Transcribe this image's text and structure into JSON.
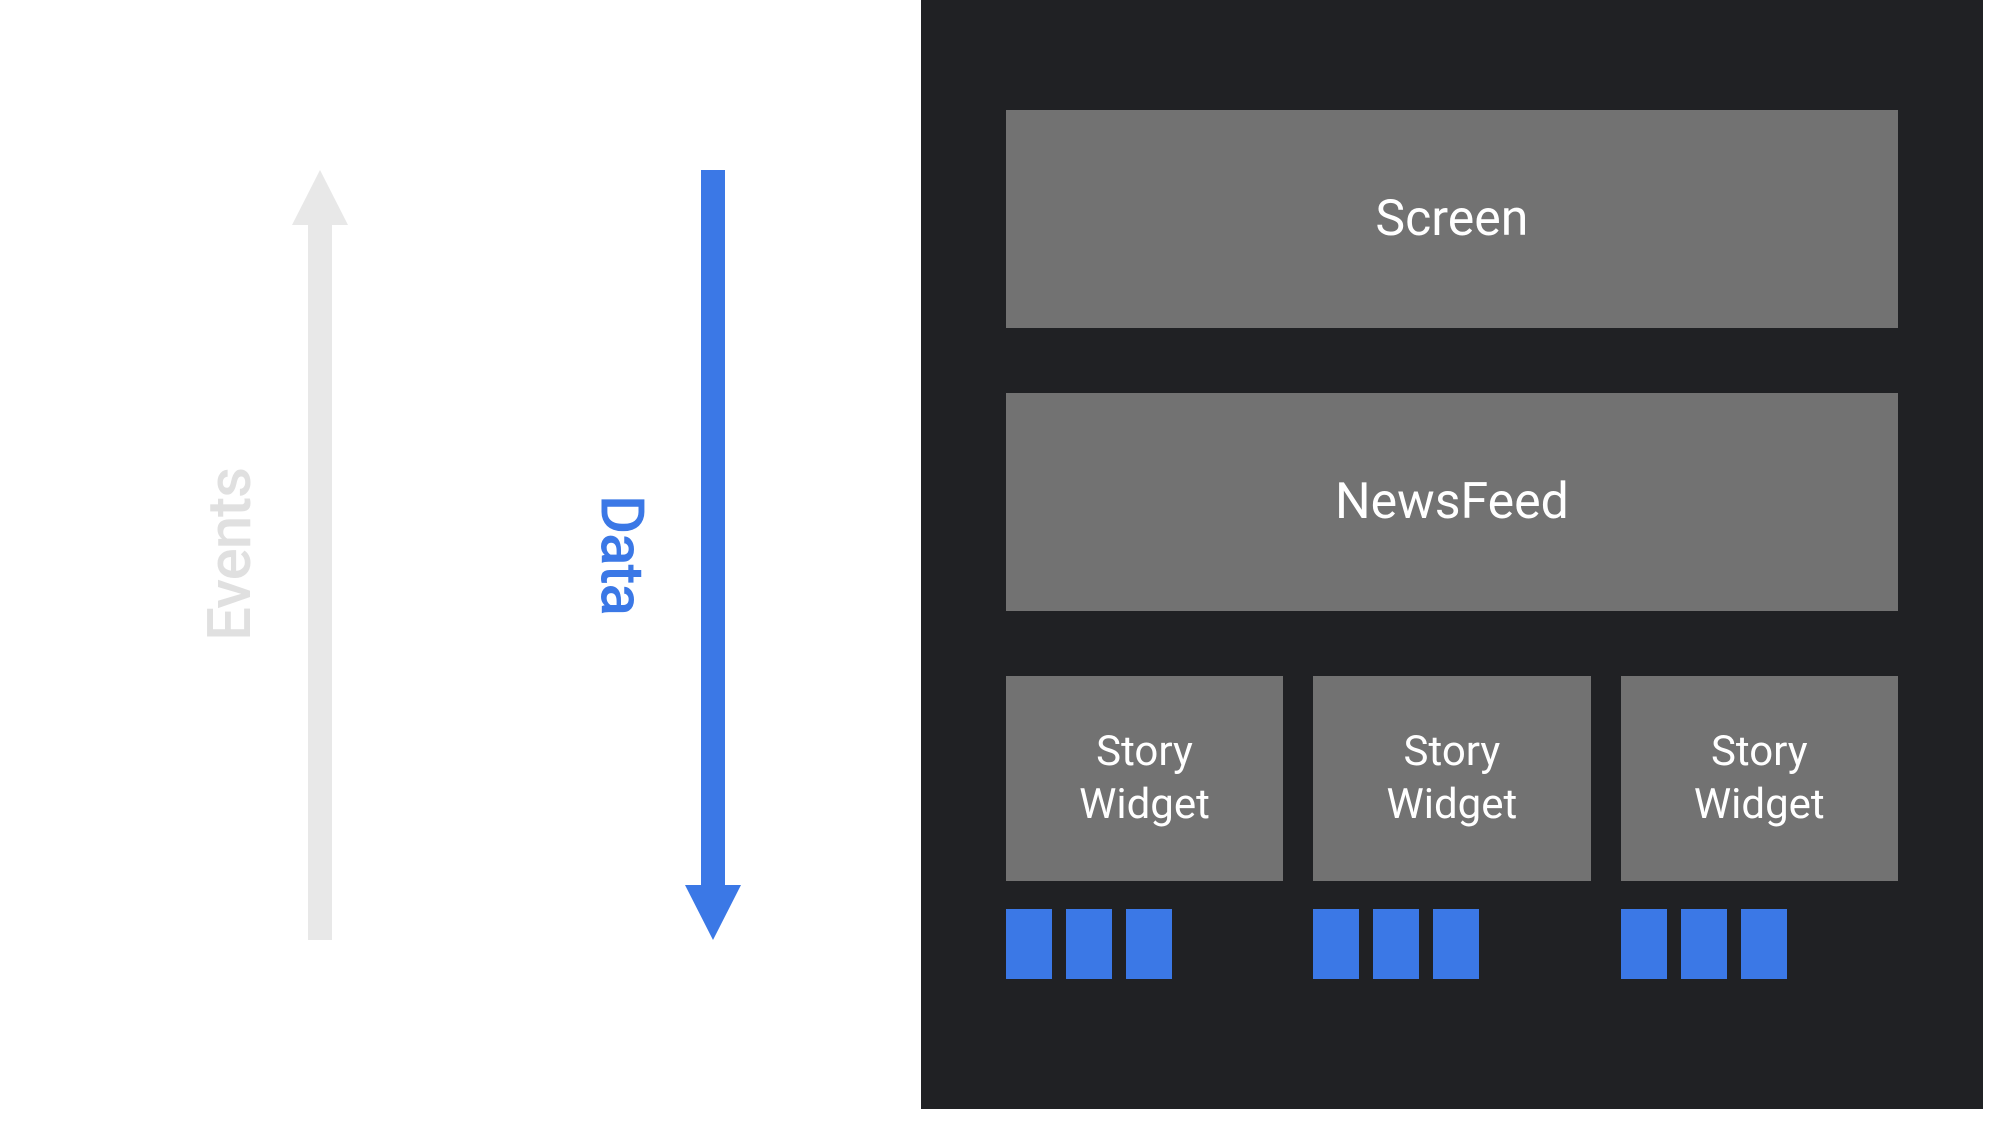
{
  "left": {
    "events_label": "Events",
    "data_label": "Data",
    "colors": {
      "events_arrow": "#e8e8e8",
      "data_arrow": "#3b78e6"
    }
  },
  "right": {
    "screen_label": "Screen",
    "newsfeed_label": "NewsFeed",
    "widgets": [
      {
        "label": "Story\nWidget"
      },
      {
        "label": "Story\nWidget"
      },
      {
        "label": "Story\nWidget"
      }
    ],
    "chips_per_widget": 3,
    "colors": {
      "panel_bg": "#202124",
      "box_bg": "#727272",
      "chip_bg": "#3b78e6"
    }
  }
}
